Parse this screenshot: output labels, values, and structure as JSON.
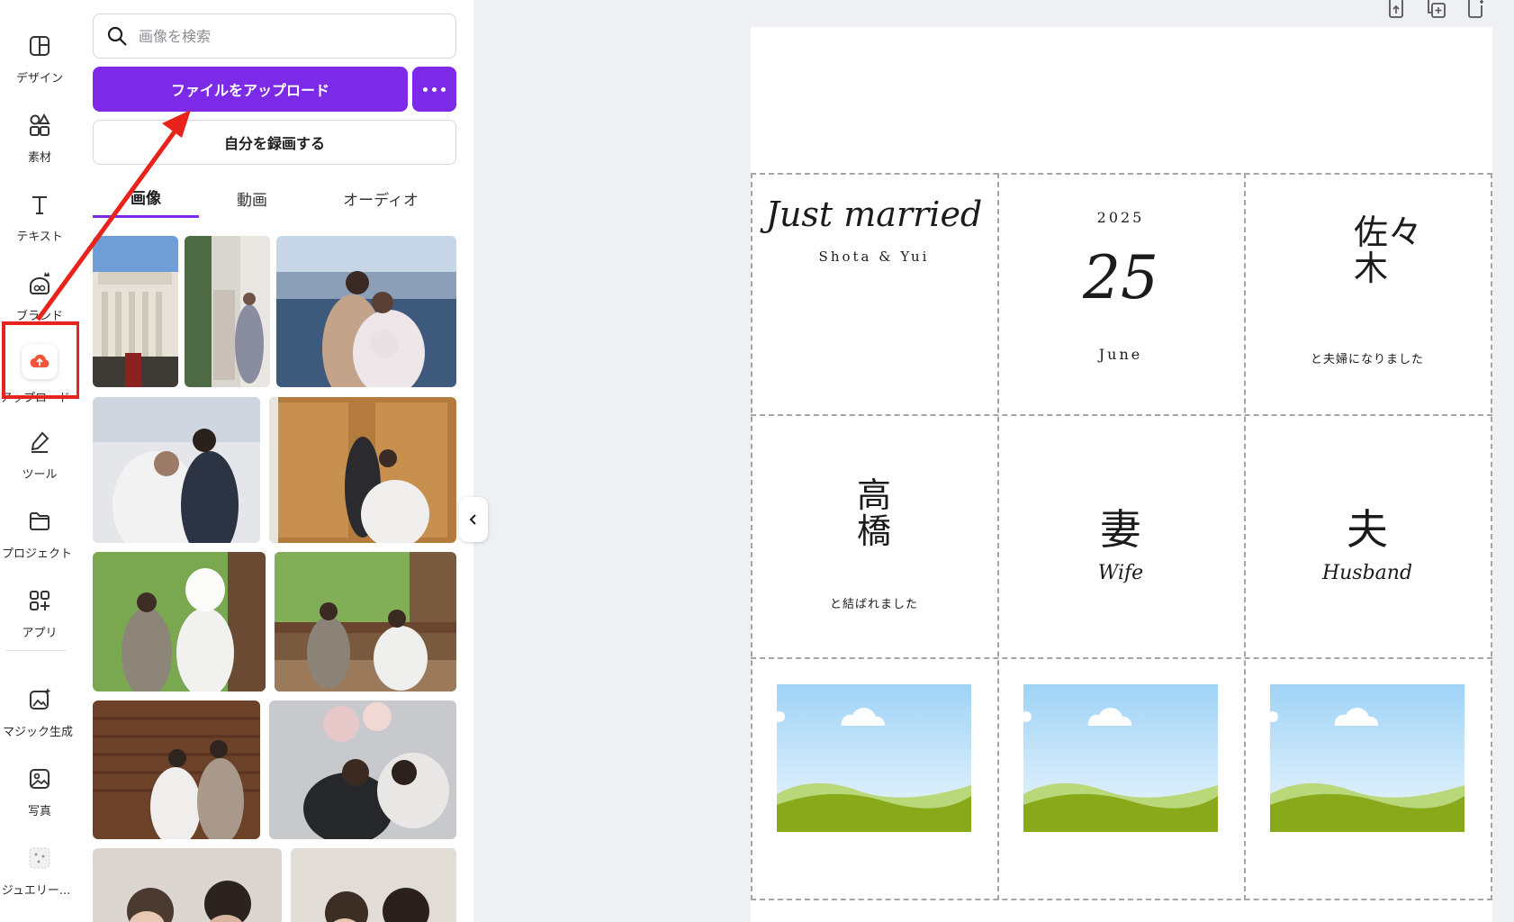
{
  "rail": {
    "items": [
      {
        "label": "デザイン",
        "icon": "layout-icon"
      },
      {
        "label": "素材",
        "icon": "elements-icon"
      },
      {
        "label": "テキスト",
        "icon": "text-icon"
      },
      {
        "label": "ブランド",
        "icon": "brand-icon"
      },
      {
        "label": "アップロード",
        "icon": "cloud-upload-icon"
      },
      {
        "label": "ツール",
        "icon": "pen-tool-icon"
      },
      {
        "label": "プロジェクト",
        "icon": "folder-icon"
      },
      {
        "label": "アプリ",
        "icon": "apps-icon"
      },
      {
        "label": "マジック生成",
        "icon": "magic-image-icon"
      },
      {
        "label": "写真",
        "icon": "photo-icon"
      },
      {
        "label": "ジュエリー...",
        "icon": "jewelry-icon"
      }
    ],
    "active_index": 4
  },
  "panel": {
    "search_placeholder": "画像を検索",
    "upload_button": "ファイルをアップロード",
    "record_button": "自分を録画する",
    "tabs": [
      "画像",
      "動画",
      "オーディオ"
    ],
    "active_tab": 0
  },
  "canvas": {
    "card1": {
      "title": "Just married",
      "subtitle": "Shota & Yui"
    },
    "card2": {
      "year": "2025",
      "day": "25",
      "month": "June"
    },
    "card3": {
      "surname": "佐々木",
      "caption": "と夫婦になりました"
    },
    "card4": {
      "surname": "高橋",
      "caption": "と結ばれました"
    },
    "card5": {
      "kanji": "妻",
      "english": "Wife"
    },
    "card6": {
      "kanji": "夫",
      "english": "Husband"
    }
  },
  "colors": {
    "accent": "#7d2ae8",
    "annotation": "#e8231b",
    "upload_icon": "#f2533a"
  }
}
